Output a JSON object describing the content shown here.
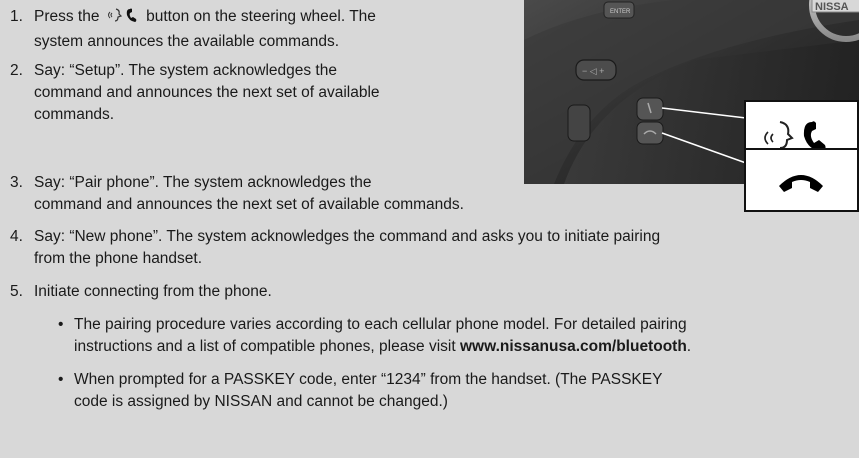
{
  "steps": [
    {
      "number": "1.",
      "before_icon": "Press the",
      "icon": "voice-phone-icon",
      "after_icon": "button on the steering wheel. The",
      "line2": "system announces the available commands."
    },
    {
      "number": "2.",
      "line1": "Say: “Setup”. The system acknowledges the",
      "line2": "command and announces the next set of available",
      "line3": "commands."
    },
    {
      "number": "3.",
      "line1": "Say: “Pair phone”. The system acknowledges the",
      "line2": "command and announces the next set of available commands."
    },
    {
      "number": "4.",
      "line1": "Say: “New phone”. The system acknowledges the command and asks you to initiate pairing",
      "line2": "from the phone handset."
    },
    {
      "number": "5.",
      "line1": "Initiate connecting from the phone."
    }
  ],
  "bullets": [
    {
      "dot": "•",
      "line1": "The pairing procedure varies according to each cellular phone model. For detailed pairing",
      "line2_prefix": "instructions and a list of compatible phones, please visit ",
      "line2_url": "www.nissanusa.com/bluetooth",
      "line2_suffix": "."
    },
    {
      "dot": "•",
      "line1": "When prompted for a PASSKEY code, enter “1234” from the handset. (The PASSKEY",
      "line2": "code is assigned by NISSAN and cannot be changed.)"
    }
  ],
  "photo": {
    "badge_text": "NISSA",
    "button_label": "ENTER",
    "callout_talk_icon": "voice-phone-icon",
    "callout_end_icon": "phone-hangup-icon"
  }
}
